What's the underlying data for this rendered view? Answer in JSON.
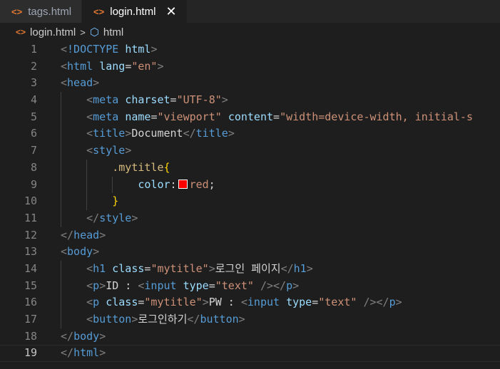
{
  "tabs": [
    {
      "name": "tags.html",
      "active": false
    },
    {
      "name": "login.html",
      "active": true,
      "close": "✕"
    }
  ],
  "breadcrumb": {
    "file": "login.html",
    "symbol": "html"
  },
  "colors": {
    "swatch": "#ff0000"
  },
  "lines": [
    {
      "n": "1",
      "tokens": [
        [
          "p",
          "<"
        ],
        [
          "tag",
          "!DOCTYPE"
        ],
        [
          "txt",
          " "
        ],
        [
          "attr",
          "html"
        ],
        [
          "p",
          ">"
        ]
      ]
    },
    {
      "n": "2",
      "tokens": [
        [
          "p",
          "<"
        ],
        [
          "tag",
          "html"
        ],
        [
          "txt",
          " "
        ],
        [
          "attr",
          "lang"
        ],
        [
          "txt",
          "="
        ],
        [
          "str",
          "\"en\""
        ],
        [
          "p",
          ">"
        ]
      ]
    },
    {
      "n": "3",
      "tokens": [
        [
          "p",
          "<"
        ],
        [
          "tag",
          "head"
        ],
        [
          "p",
          ">"
        ]
      ]
    },
    {
      "n": "4",
      "tokens": [
        [
          "txt",
          "    "
        ],
        [
          "p",
          "<"
        ],
        [
          "tag",
          "meta"
        ],
        [
          "txt",
          " "
        ],
        [
          "attr",
          "charset"
        ],
        [
          "txt",
          "="
        ],
        [
          "str",
          "\"UTF-8\""
        ],
        [
          "p",
          ">"
        ]
      ]
    },
    {
      "n": "5",
      "tokens": [
        [
          "txt",
          "    "
        ],
        [
          "p",
          "<"
        ],
        [
          "tag",
          "meta"
        ],
        [
          "txt",
          " "
        ],
        [
          "attr",
          "name"
        ],
        [
          "txt",
          "="
        ],
        [
          "str",
          "\"viewport\""
        ],
        [
          "txt",
          " "
        ],
        [
          "attr",
          "content"
        ],
        [
          "txt",
          "="
        ],
        [
          "str",
          "\"width=device-width, initial-s"
        ]
      ]
    },
    {
      "n": "6",
      "tokens": [
        [
          "txt",
          "    "
        ],
        [
          "p",
          "<"
        ],
        [
          "tag",
          "title"
        ],
        [
          "p",
          ">"
        ],
        [
          "txt",
          "Document"
        ],
        [
          "p",
          "</"
        ],
        [
          "tag",
          "title"
        ],
        [
          "p",
          ">"
        ]
      ]
    },
    {
      "n": "7",
      "tokens": [
        [
          "txt",
          "    "
        ],
        [
          "p",
          "<"
        ],
        [
          "tag",
          "style"
        ],
        [
          "p",
          ">"
        ]
      ]
    },
    {
      "n": "8",
      "tokens": [
        [
          "txt",
          "        "
        ],
        [
          "sel",
          ".mytitle"
        ],
        [
          "brace",
          "{"
        ]
      ]
    },
    {
      "n": "9",
      "tokens": [
        [
          "txt",
          "            "
        ],
        [
          "attr",
          "color"
        ],
        [
          "txt",
          ":"
        ],
        [
          "swatch",
          ""
        ],
        [
          "str",
          "red"
        ],
        [
          "txt",
          ";"
        ]
      ]
    },
    {
      "n": "10",
      "tokens": [
        [
          "txt",
          "        "
        ],
        [
          "brace",
          "}"
        ]
      ]
    },
    {
      "n": "11",
      "tokens": [
        [
          "txt",
          "    "
        ],
        [
          "p",
          "</"
        ],
        [
          "tag",
          "style"
        ],
        [
          "p",
          ">"
        ]
      ]
    },
    {
      "n": "12",
      "tokens": [
        [
          "p",
          "</"
        ],
        [
          "tag",
          "head"
        ],
        [
          "p",
          ">"
        ]
      ]
    },
    {
      "n": "13",
      "tokens": [
        [
          "p",
          "<"
        ],
        [
          "tag",
          "body"
        ],
        [
          "p",
          ">"
        ]
      ]
    },
    {
      "n": "14",
      "tokens": [
        [
          "txt",
          "    "
        ],
        [
          "p",
          "<"
        ],
        [
          "tag",
          "h1"
        ],
        [
          "txt",
          " "
        ],
        [
          "attr",
          "class"
        ],
        [
          "txt",
          "="
        ],
        [
          "str",
          "\"mytitle\""
        ],
        [
          "p",
          ">"
        ],
        [
          "txt",
          "로그인 페이지"
        ],
        [
          "p",
          "</"
        ],
        [
          "tag",
          "h1"
        ],
        [
          "p",
          ">"
        ]
      ]
    },
    {
      "n": "15",
      "tokens": [
        [
          "txt",
          "    "
        ],
        [
          "p",
          "<"
        ],
        [
          "tag",
          "p"
        ],
        [
          "p",
          ">"
        ],
        [
          "txt",
          "ID : "
        ],
        [
          "p",
          "<"
        ],
        [
          "tag",
          "input"
        ],
        [
          "txt",
          " "
        ],
        [
          "attr",
          "type"
        ],
        [
          "txt",
          "="
        ],
        [
          "str",
          "\"text\""
        ],
        [
          "txt",
          " "
        ],
        [
          "p",
          "/></"
        ],
        [
          "tag",
          "p"
        ],
        [
          "p",
          ">"
        ]
      ]
    },
    {
      "n": "16",
      "tokens": [
        [
          "txt",
          "    "
        ],
        [
          "p",
          "<"
        ],
        [
          "tag",
          "p"
        ],
        [
          "txt",
          " "
        ],
        [
          "attr",
          "class"
        ],
        [
          "txt",
          "="
        ],
        [
          "str",
          "\"mytitle\""
        ],
        [
          "p",
          ">"
        ],
        [
          "txt",
          "PW : "
        ],
        [
          "p",
          "<"
        ],
        [
          "tag",
          "input"
        ],
        [
          "txt",
          " "
        ],
        [
          "attr",
          "type"
        ],
        [
          "txt",
          "="
        ],
        [
          "str",
          "\"text\""
        ],
        [
          "txt",
          " "
        ],
        [
          "p",
          "/></"
        ],
        [
          "tag",
          "p"
        ],
        [
          "p",
          ">"
        ]
      ]
    },
    {
      "n": "17",
      "tokens": [
        [
          "txt",
          "    "
        ],
        [
          "p",
          "<"
        ],
        [
          "tag",
          "button"
        ],
        [
          "p",
          ">"
        ],
        [
          "txt",
          "로그인하기"
        ],
        [
          "p",
          "</"
        ],
        [
          "tag",
          "button"
        ],
        [
          "p",
          ">"
        ]
      ]
    },
    {
      "n": "18",
      "tokens": [
        [
          "p",
          "</"
        ],
        [
          "tag",
          "body"
        ],
        [
          "p",
          ">"
        ]
      ]
    },
    {
      "n": "19",
      "tokens": [
        [
          "p",
          "</"
        ],
        [
          "tag",
          "html"
        ],
        [
          "p",
          ">"
        ]
      ],
      "current": true
    }
  ]
}
